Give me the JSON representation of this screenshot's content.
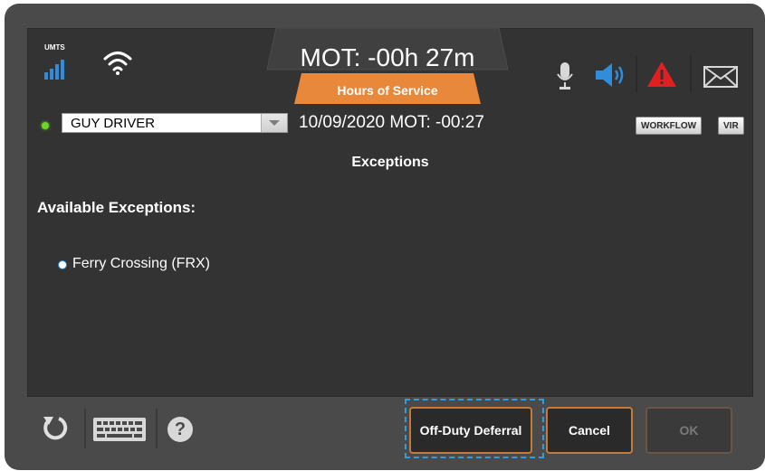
{
  "header": {
    "network_label": "UMTS",
    "mot_title": "MOT: -00h 27m",
    "hos_label": "Hours of Service",
    "icons": [
      "signal-bars-icon",
      "wifi-icon",
      "microphone-icon",
      "speaker-icon",
      "alert-icon",
      "mail-icon"
    ],
    "colors": {
      "accent_blue": "#2f8ddb",
      "hos_orange": "#e8883a",
      "alert_red": "#e02020"
    }
  },
  "driver_bar": {
    "driver": "GUY DRIVER",
    "datetime": "10/09/2020  MOT: -00:27",
    "workflow_label": "WORKFLOW",
    "vir_label": "VIR"
  },
  "page": {
    "title": "Exceptions",
    "available_label": "Available Exceptions:",
    "options": [
      {
        "label": "Ferry Crossing (FRX)"
      }
    ]
  },
  "footer": {
    "icons": [
      "refresh-icon",
      "keyboard-icon",
      "help-icon"
    ],
    "help_glyph": "?",
    "buttons": {
      "off_duty_deferral": "Off-Duty Deferral",
      "cancel": "Cancel",
      "ok": "OK"
    },
    "colors": {
      "button_border": "#c57a3a",
      "focus_ring": "#2f9de0"
    }
  }
}
